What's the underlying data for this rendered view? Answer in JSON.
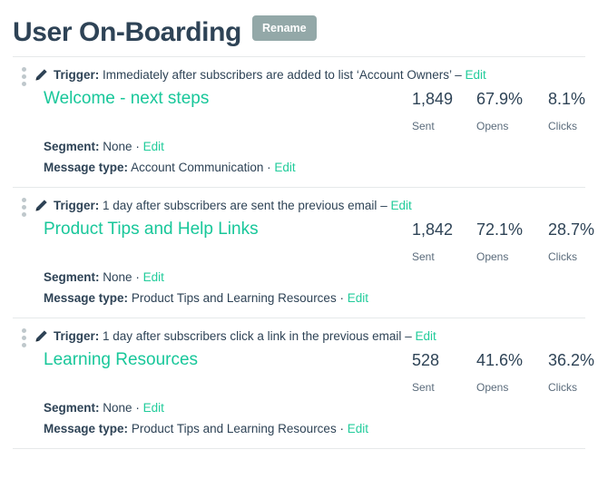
{
  "header": {
    "title": "User On-Boarding",
    "rename_label": "Rename"
  },
  "colors": {
    "title": "#2e4356",
    "link_teal": "#22cc9b",
    "campaign_teal": "#18c79a",
    "rename_button": "#93a8a8",
    "divider": "#e6e9ea",
    "stat_label": "#5a6b7b"
  },
  "labels": {
    "trigger_label": "Trigger:",
    "segment_label": "Segment:",
    "message_type_label": "Message type:",
    "edit_label": "Edit",
    "dash": "–",
    "middot": "·",
    "sent_label": "Sent",
    "opens_label": "Opens",
    "clicks_label": "Clicks"
  },
  "campaigns": [
    {
      "trigger_text": "Immediately after subscribers are added to list ‘Account Owners’",
      "trigger_edit": "Edit",
      "name": "Welcome - next steps",
      "sent": "1,849",
      "opens": "67.9%",
      "clicks": "8.1%",
      "segment_value": "None",
      "segment_edit": "Edit",
      "message_type_value": "Account Communication",
      "message_type_edit": "Edit"
    },
    {
      "trigger_text": "1 day after subscribers are sent the previous email",
      "trigger_edit": "Edit",
      "name": "Product Tips and Help Links",
      "sent": "1,842",
      "opens": "72.1%",
      "clicks": "28.7%",
      "segment_value": "None",
      "segment_edit": "Edit",
      "message_type_value": "Product Tips and Learning Resources",
      "message_type_edit": "Edit"
    },
    {
      "trigger_text": "1 day after subscribers click a link in the previous email",
      "trigger_edit": "Edit",
      "name": "Learning Resources",
      "sent": "528",
      "opens": "41.6%",
      "clicks": "36.2%",
      "segment_value": "None",
      "segment_edit": "Edit",
      "message_type_value": "Product Tips and Learning Resources",
      "message_type_edit": "Edit"
    }
  ]
}
